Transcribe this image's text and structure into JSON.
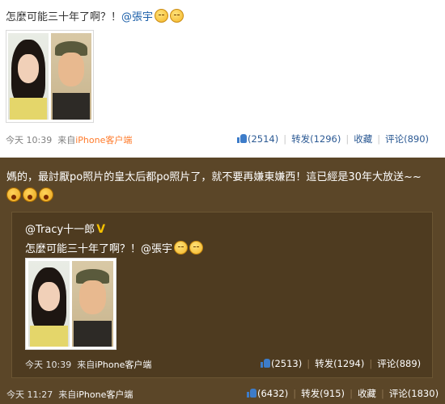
{
  "original_post": {
    "text": "怎麼可能三十年了啊？！",
    "mention": "@張宇",
    "emojis": [
      "sleepy-emoji",
      "sleepy-emoji"
    ],
    "time": "今天 10:39",
    "source_prefix": "来自",
    "source": "iPhone客户端",
    "likes": "(2514)",
    "repost": "转发(1296)",
    "favorite": "收藏",
    "comment": "评论(890)"
  },
  "repost": {
    "text": "媽的，最討厭po照片的皇太后都po照片了，就不要再嫌東嫌西！這已經是30年大放送~~",
    "emojis": [
      "shocked-emoji",
      "shocked-emoji",
      "shocked-emoji"
    ],
    "quoted": {
      "author": "@Tracy十一郎",
      "verified_badge": "V",
      "text": "怎麼可能三十年了啊？！",
      "mention": "@張宇",
      "time": "今天 10:39",
      "source_prefix": "来自",
      "source": "iPhone客户端",
      "likes": "(2513)",
      "repost": "转发(1294)",
      "comment": "评论(889)"
    },
    "time": "今天 11:27",
    "source_prefix": "来自",
    "source": "iPhone客户端",
    "likes": "(6432)",
    "repost_label": "转发(915)",
    "favorite": "收藏",
    "comment": "评论(1830)"
  },
  "colors": {
    "link": "#2c5a94",
    "source_orange": "#ff7a2a",
    "dark_bg": "#5b4628",
    "badge": "#f4c000"
  }
}
